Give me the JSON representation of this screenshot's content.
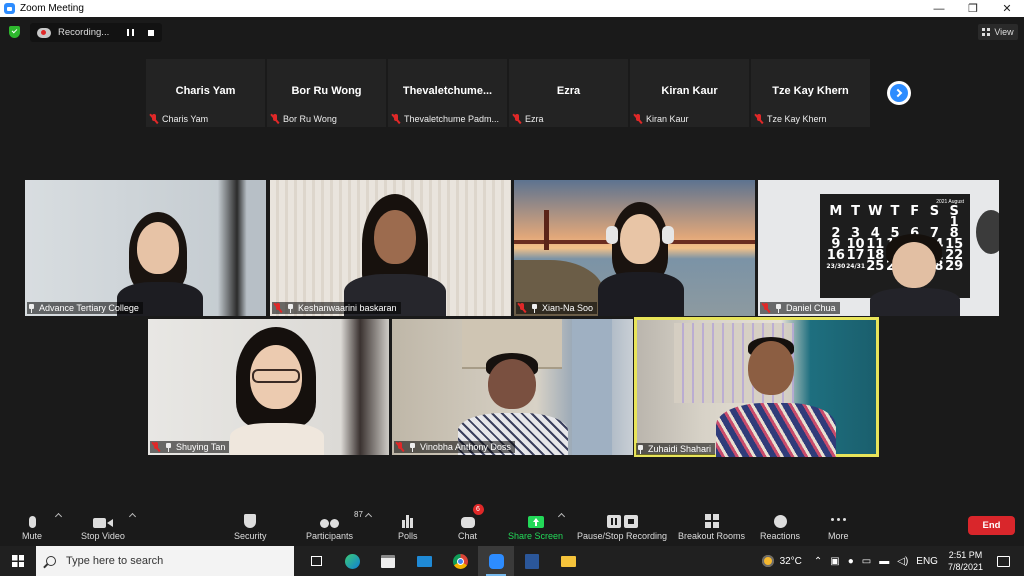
{
  "window": {
    "title": "Zoom Meeting",
    "minimize": "—",
    "maximize": "❐",
    "close": "✕"
  },
  "recording": {
    "label": "Recording..."
  },
  "view": {
    "label": "View"
  },
  "strip": [
    {
      "name": "Charis Yam",
      "tag": "Charis Yam"
    },
    {
      "name": "Bor Ru Wong",
      "tag": "Bor Ru Wong"
    },
    {
      "name": "Thevaletchume...",
      "tag": "Thevaletchume Padm..."
    },
    {
      "name": "Ezra",
      "tag": "Ezra"
    },
    {
      "name": "Kiran Kaur",
      "tag": "Kiran Kaur"
    },
    {
      "name": "Tze Kay Khern",
      "tag": "Tze Kay Khern"
    }
  ],
  "tiles": [
    {
      "name": "Advance Tertiary College",
      "muted": false
    },
    {
      "name": "Keshanwaarini baskaran",
      "muted": true
    },
    {
      "name": "Xian-Na Soo",
      "muted": true
    },
    {
      "name": "Daniel Chua",
      "muted": true
    },
    {
      "name": "Shuying Tan",
      "muted": true
    },
    {
      "name": "Vinobha Anthony Doss",
      "muted": true
    },
    {
      "name": "Zuhaidi Shahari",
      "muted": false
    }
  ],
  "calendar": {
    "year_month": "2021  August",
    "days": [
      "M",
      "T",
      "W",
      "T",
      "F",
      "S",
      "S"
    ],
    "rows": [
      [
        "",
        "",
        "",
        "",
        "",
        "",
        "1"
      ],
      [
        "2",
        "3",
        "4",
        "5",
        "6",
        "7",
        "8"
      ],
      [
        "9",
        "10",
        "11",
        "12",
        "13",
        "14",
        "15"
      ],
      [
        "16",
        "17",
        "18",
        "19",
        "20",
        "21",
        "22"
      ],
      [
        "23/30",
        "24/31",
        "25",
        "26",
        "27",
        "28",
        "29"
      ]
    ]
  },
  "toolbar": {
    "mute": "Mute",
    "stop_video": "Stop Video",
    "security": "Security",
    "participants": "Participants",
    "participants_count": "87",
    "polls": "Polls",
    "chat": "Chat",
    "chat_badge": "6",
    "share_screen": "Share Screen",
    "pause_stop_recording": "Pause/Stop Recording",
    "breakout_rooms": "Breakout Rooms",
    "reactions": "Reactions",
    "more": "More",
    "end": "End"
  },
  "taskbar": {
    "search_placeholder": "Type here to search",
    "weather": "32°C",
    "language": "ENG",
    "time": "2:51 PM",
    "date": "7/8/2021"
  },
  "colors": {
    "zoom_blue": "#2d8cff",
    "end_red": "#d9262b",
    "share_green": "#23d959",
    "active_speaker": "#e8e45a"
  }
}
